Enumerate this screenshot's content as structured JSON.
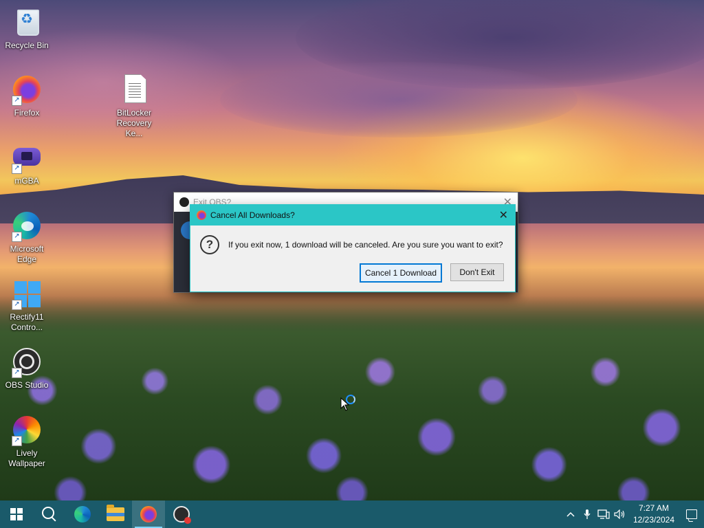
{
  "desktop": {
    "icons": [
      {
        "label": "Recycle Bin",
        "icon": "recycle-bin-icon",
        "shortcut": false
      },
      {
        "label": "Firefox",
        "icon": "firefox-icon",
        "shortcut": true
      },
      {
        "label": "BitLocker Recovery Ke...",
        "icon": "text-document-icon",
        "shortcut": false
      },
      {
        "label": "mGBA",
        "icon": "mgba-icon",
        "shortcut": true
      },
      {
        "label": "Microsoft Edge",
        "icon": "edge-icon",
        "shortcut": true
      },
      {
        "label": "Rectify11 Contro...",
        "icon": "rectify11-icon",
        "shortcut": true
      },
      {
        "label": "OBS Studio",
        "icon": "obs-studio-icon",
        "shortcut": true
      },
      {
        "label": "Lively Wallpaper",
        "icon": "lively-wallpaper-icon",
        "shortcut": true
      }
    ]
  },
  "obs_dialog": {
    "title": "Exit OBS?",
    "close_glyph": "✕"
  },
  "firefox_dialog": {
    "title": "Cancel All Downloads?",
    "close_glyph": "✕",
    "question_glyph": "?",
    "message": "If you exit now, 1 download will be canceled. Are you sure you want to exit?",
    "primary_button": "Cancel 1 Download",
    "secondary_button": "Don't Exit",
    "accent_color": "#2bc6c6"
  },
  "taskbar": {
    "color": "#1a5a6a",
    "apps": [
      {
        "name": "start",
        "icon": "windows-start-icon"
      },
      {
        "name": "search",
        "icon": "search-icon"
      },
      {
        "name": "edge",
        "icon": "edge-icon"
      },
      {
        "name": "file-explorer",
        "icon": "folder-icon"
      },
      {
        "name": "firefox",
        "icon": "firefox-icon",
        "active": true
      },
      {
        "name": "obs-studio",
        "icon": "obs-studio-icon"
      }
    ],
    "tray": {
      "chevron": "^",
      "time": "7:27 AM",
      "date": "12/23/2024"
    }
  }
}
